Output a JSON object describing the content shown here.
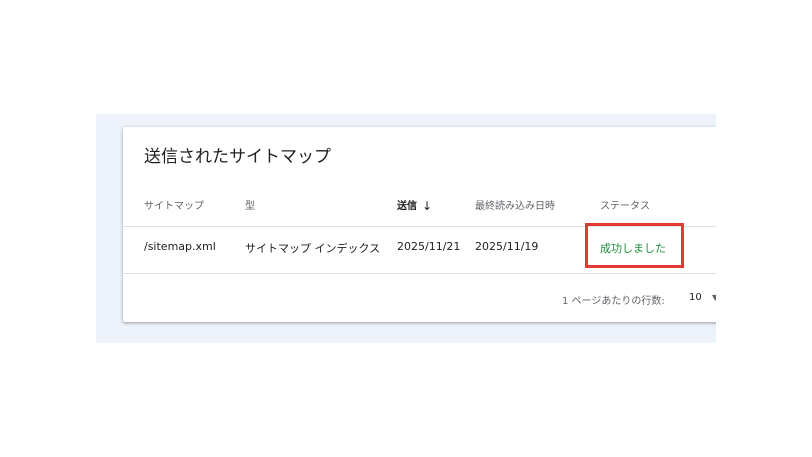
{
  "card": {
    "title": "送信されたサイトマップ"
  },
  "table": {
    "columns": [
      "サイトマップ",
      "型",
      "送信",
      "最終読み込み日時",
      "ステータス"
    ],
    "sorted_column": "送信",
    "sort_direction_icon": "arrow-down-icon",
    "rows": [
      {
        "sitemap": "/sitemap.xml",
        "type": "サイトマップ インデックス",
        "submitted": "2025/11/21",
        "last_read": "2025/11/19",
        "status": "成功しました"
      }
    ]
  },
  "pagination": {
    "rows_per_page_label": "1 ページあたりの行数:",
    "rows_per_page_value": "10"
  },
  "colors": {
    "status_success": "#1e8e3e",
    "highlight": "#e53935",
    "backdrop": "#eef2fa"
  }
}
